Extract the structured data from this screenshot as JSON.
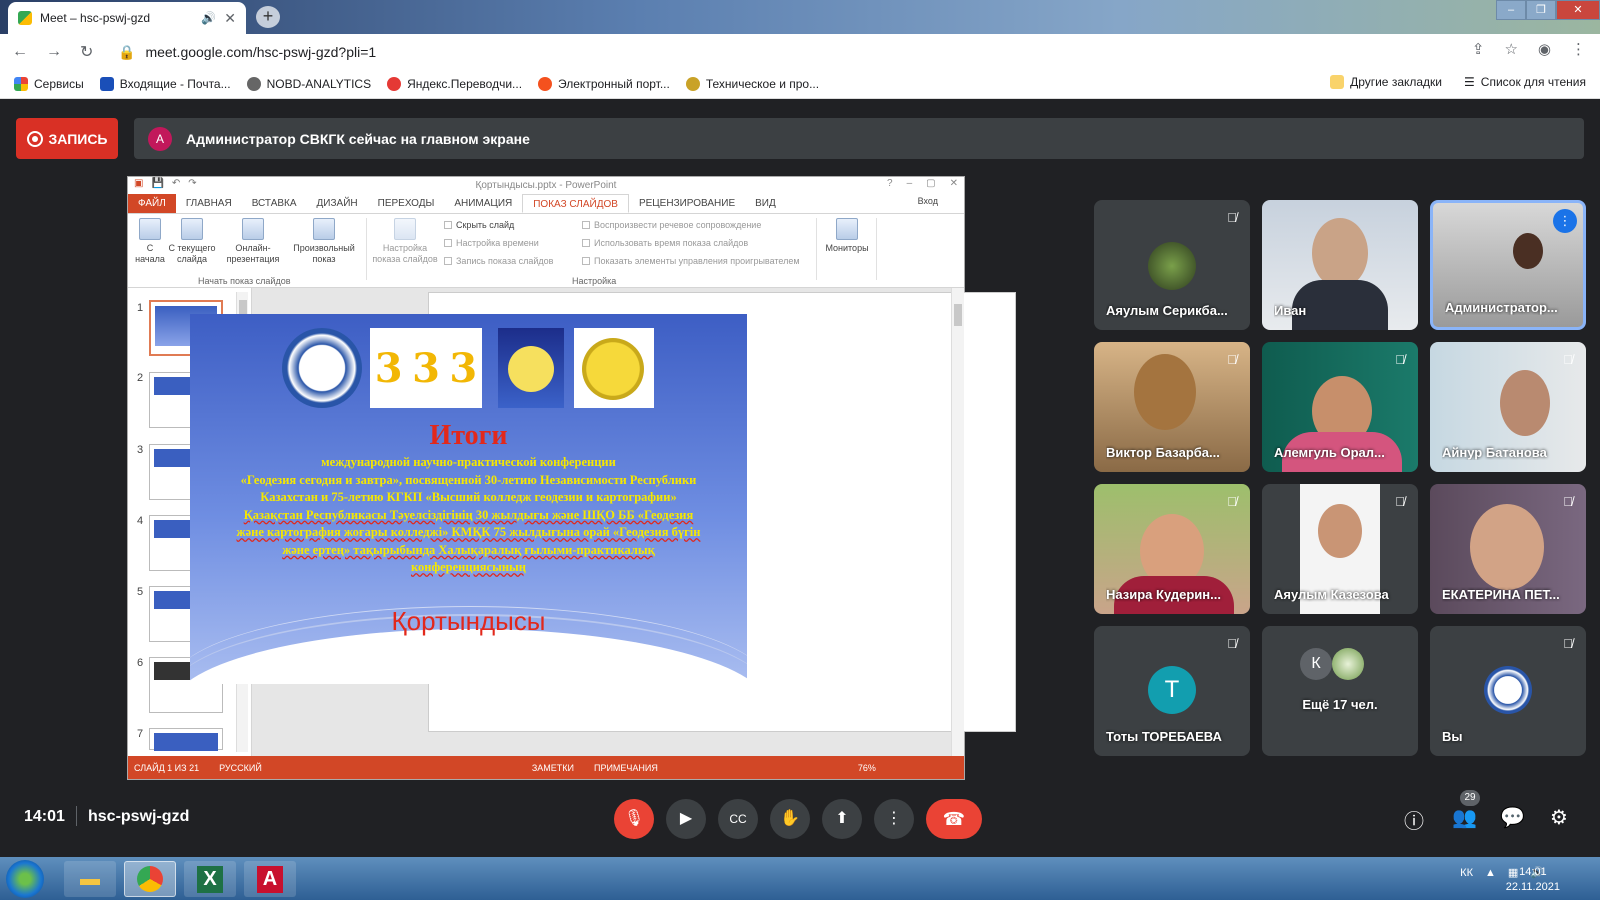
{
  "browser": {
    "tab_title": "Meet – hsc-pswj-gzd",
    "url": "meet.google.com/hsc-pswj-gzd?pli=1",
    "bookmarks": [
      "Сервисы",
      "Входящие - Почта...",
      "NOBD-ANALYTICS",
      "Яндекс.Переводчи...",
      "Электронный порт...",
      "Техническое и про..."
    ],
    "bookmarks_right": [
      "Другие закладки",
      "Список для чтения"
    ]
  },
  "meet": {
    "record_label": "ЗАПИСЬ",
    "notice_avatar": "А",
    "notice_text": "Администратор СВКГК сейчас на главном экране",
    "time": "14:01",
    "meeting_code": "hsc-pswj-gzd",
    "participants_count": "29",
    "tiles": [
      {
        "name": "Аяулым Серикба...",
        "muted": true
      },
      {
        "name": "Иван",
        "muted": false
      },
      {
        "name": "Администратор...",
        "muted": false,
        "speaking": true
      },
      {
        "name": "Виктор Базарба...",
        "muted": true
      },
      {
        "name": "Алемгуль Орал...",
        "muted": true
      },
      {
        "name": "Айнур Батанова",
        "muted": true
      },
      {
        "name": "Назира Кудерин...",
        "muted": true
      },
      {
        "name": "Аяулым Казезова",
        "muted": true
      },
      {
        "name": "ЕКАТЕРИНА ПЕТ...",
        "muted": true
      },
      {
        "name": "Тоты ТОРЕБАЕВА",
        "muted": true,
        "avatar": "Т"
      },
      {
        "name": "Ещё 17 чел.",
        "avatar": "К"
      },
      {
        "name": "Вы",
        "muted": true
      }
    ]
  },
  "ppt": {
    "window_title": "Қортындысы.pptx - PowerPoint",
    "tabs": [
      "ФАЙЛ",
      "ГЛАВНАЯ",
      "ВСТАВКА",
      "ДИЗАЙН",
      "ПЕРЕХОДЫ",
      "АНИМАЦИЯ",
      "ПОКАЗ СЛАЙДОВ",
      "РЕЦЕНЗИРОВАНИЕ",
      "ВИД"
    ],
    "login": "Вход",
    "ribbon": {
      "btn1": "С начала",
      "btn2": "С текущего слайда",
      "btn3": "Онлайн-презентация",
      "btn4": "Произвольный показ",
      "group1": "Начать показ слайдов",
      "btn5": "Настройка показа слайдов",
      "hide": "Скрыть слайд",
      "timing": "Настройка времени",
      "record": "Запись показа слайдов",
      "chk1": "Воспроизвести речевое сопровождение",
      "chk2": "Использовать время показа слайдов",
      "chk3": "Показать элементы управления проигрывателем",
      "group2": "Настройка",
      "monitors": "Мониторы"
    },
    "thumb_numbers": [
      "1",
      "2",
      "3",
      "4",
      "5",
      "6",
      "7"
    ],
    "status": {
      "slide": "СЛАЙД 1 ИЗ 21",
      "lang": "РУССКИЙ",
      "notes": "ЗАМЕТКИ",
      "comments": "ПРИМЕЧАНИЯ",
      "zoom": "76%"
    },
    "slide": {
      "title": "Итоги",
      "line1": "международной научно-практической конференции",
      "line2": "«Геодезия сегодня и завтра», посвященной 30-летию Независимости Республики Казахстан и 75-летию КГКП «Высший колледж геодезии и картографии»",
      "line3": "Қазақстан Республикасы Тәуелсіздігінің 30 жылдығы және ШҚО ББ «Геодезия және картография жоғары колледжі» КМҚК 75 жылдығына орай «Геодезия бүгін және ертең» тақырыбында Халықаралық ғылыми-практикалық конференциясының",
      "bottom": "Қортындысы"
    }
  },
  "taskbar": {
    "lang": "КК",
    "time": "14:01",
    "date": "22.11.2021"
  }
}
